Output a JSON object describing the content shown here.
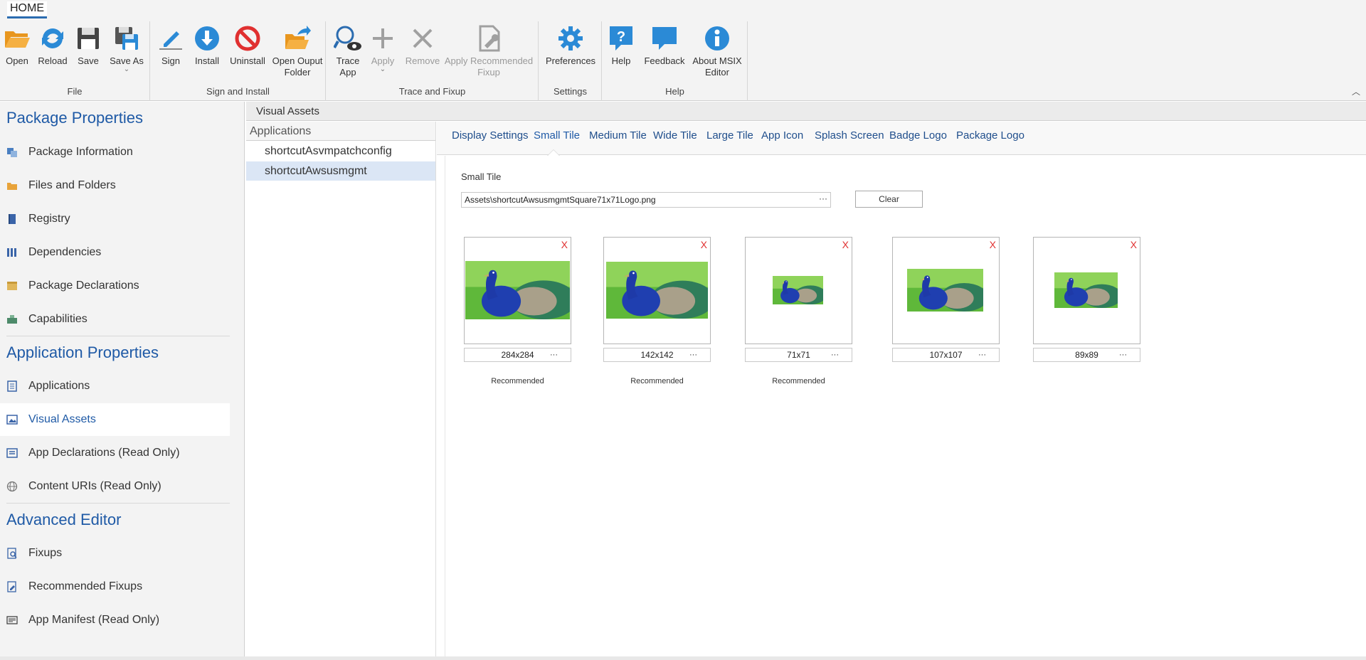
{
  "ribbon": {
    "tab": "HOME",
    "groups": [
      {
        "label": "File",
        "buttons": [
          "Open",
          "Reload",
          "Save",
          "Save As"
        ]
      },
      {
        "label": "Sign and Install",
        "buttons": [
          "Sign",
          "Install",
          "Uninstall",
          "Open Ouput Folder"
        ]
      },
      {
        "label": "Trace and Fixup",
        "buttons": [
          "Trace App",
          "Apply",
          "Remove",
          "Apply Recommended Fixup"
        ]
      },
      {
        "label": "Settings",
        "buttons": [
          "Preferences"
        ]
      },
      {
        "label": "Help",
        "buttons": [
          "Help",
          "Feedback",
          "About MSIX Editor"
        ]
      }
    ],
    "labels": {
      "open": "Open",
      "reload": "Reload",
      "save": "Save",
      "save_as": "Save As",
      "sign": "Sign",
      "install": "Install",
      "uninstall": "Uninstall",
      "open_output_1": "Open Ouput",
      "open_output_2": "Folder",
      "trace_1": "Trace",
      "trace_2": "App",
      "apply": "Apply",
      "remove": "Remove",
      "apply_rec_1": "Apply Recommended",
      "apply_rec_2": "Fixup",
      "preferences": "Preferences",
      "help": "Help",
      "feedback": "Feedback",
      "about_1": "About MSIX",
      "about_2": "Editor",
      "group_file": "File",
      "group_sign": "Sign and Install",
      "group_trace": "Trace and Fixup",
      "group_settings": "Settings",
      "group_help": "Help"
    },
    "colors": {
      "accent": "#2b8ad6",
      "folder": "#f0a030",
      "red": "#e03030",
      "disabled": "#9a9a9a"
    }
  },
  "sidebar": {
    "package_title": "Package Properties",
    "package_items": [
      "Package Information",
      "Files and Folders",
      "Registry",
      "Dependencies",
      "Package Declarations",
      "Capabilities"
    ],
    "app_title": "Application Properties",
    "app_items": [
      "Applications",
      "Visual Assets",
      "App Declarations (Read Only)",
      "Content URIs (Read Only)"
    ],
    "advanced_title": "Advanced Editor",
    "advanced_items": [
      "Fixups",
      "Recommended Fixups",
      "App Manifest (Read Only)"
    ],
    "active_item": "Visual Assets"
  },
  "main": {
    "header": "Visual Assets",
    "apps_header": "Applications",
    "apps": [
      "shortcutAsvmpatchconfig",
      "shortcutAwsusmgmt"
    ],
    "selected_app": "shortcutAwsusmgmt",
    "tabs": [
      "Display Settings",
      "Small Tile",
      "Medium Tile",
      "Wide Tile",
      "Large Tile",
      "App Icon",
      "Splash Screen",
      "Badge Logo",
      "Package Logo"
    ],
    "active_tab": "Small Tile",
    "tile_label": "Small Tile",
    "path_value": "Assets\\shortcutAwsusmgmtSquare71x71Logo.png",
    "browse": "···",
    "clear_label": "Clear",
    "remove_mark": "X",
    "dots": "···",
    "assets": [
      {
        "size": "284x284",
        "recommended": "Recommended"
      },
      {
        "size": "142x142",
        "recommended": "Recommended"
      },
      {
        "size": "71x71",
        "recommended": "Recommended"
      },
      {
        "size": "107x107",
        "recommended": ""
      },
      {
        "size": "89x89",
        "recommended": ""
      }
    ]
  }
}
